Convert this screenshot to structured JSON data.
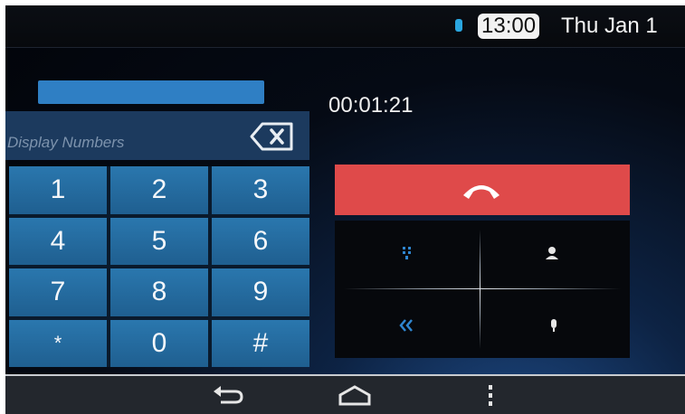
{
  "status_bar": {
    "icon": "bluetooth-icon",
    "time": "13:00",
    "date": "Thu Jan 1"
  },
  "call": {
    "duration": "00:01:21"
  },
  "keypad": {
    "display_placeholder": "Display Numbers",
    "keys": [
      "1",
      "2",
      "3",
      "4",
      "5",
      "6",
      "7",
      "8",
      "9",
      "*",
      "0",
      "#"
    ]
  },
  "controls": {
    "end_call_icon": "end-call-icon",
    "items": [
      "keypad-icon",
      "contact-icon",
      "transfer-audio-icon",
      "mute-microphone-icon"
    ]
  },
  "nav_bar": {
    "items": [
      "back-icon",
      "home-icon",
      "menu-icon"
    ]
  },
  "colors": {
    "end_call": "#df4a4a",
    "key": "#2a77ae",
    "accent": "#2aa6e0"
  }
}
